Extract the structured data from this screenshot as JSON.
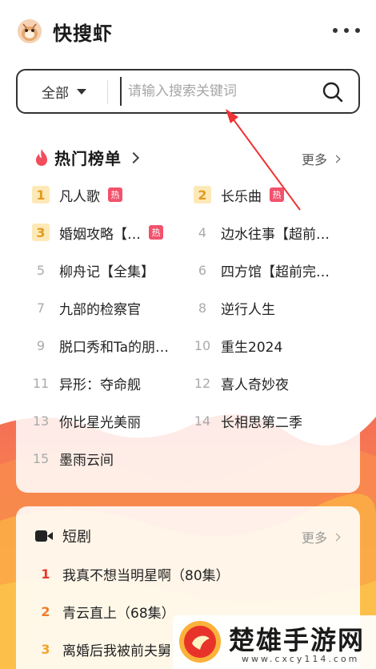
{
  "app": {
    "title": "快搜虾",
    "logo_icon": "shrimp-mascot-avatar"
  },
  "header": {
    "more_icon": "more-dots-icon"
  },
  "search": {
    "scope_label": "全部",
    "placeholder": "请输入搜索关键词",
    "value": ""
  },
  "hot_list": {
    "title": "热门榜单",
    "more_label": "更多",
    "hot_badge": "热",
    "items": [
      {
        "rank": "1",
        "name": "凡人歌",
        "hot": true
      },
      {
        "rank": "2",
        "name": "长乐曲",
        "hot": true
      },
      {
        "rank": "3",
        "name": "婚姻攻略【…",
        "hot": true
      },
      {
        "rank": "4",
        "name": "边水往事【超前…",
        "hot": false
      },
      {
        "rank": "5",
        "name": "柳舟记【全集】",
        "hot": false
      },
      {
        "rank": "6",
        "name": "四方馆【超前完…",
        "hot": false
      },
      {
        "rank": "7",
        "name": "九部的检察官",
        "hot": false
      },
      {
        "rank": "8",
        "name": "逆行人生",
        "hot": false
      },
      {
        "rank": "9",
        "name": "脱口秀和Ta的朋…",
        "hot": false
      },
      {
        "rank": "10",
        "name": "重生2024",
        "hot": false
      },
      {
        "rank": "11",
        "name": "异形：夺命舰",
        "hot": false
      },
      {
        "rank": "12",
        "name": "喜人奇妙夜",
        "hot": false
      },
      {
        "rank": "13",
        "name": "你比星光美丽",
        "hot": false
      },
      {
        "rank": "14",
        "name": "长相思第二季",
        "hot": false
      },
      {
        "rank": "15",
        "name": "墨雨云间",
        "hot": false
      }
    ]
  },
  "short_drama": {
    "title": "短剧",
    "more_label": "更多",
    "items": [
      {
        "rank": "1",
        "name": "我真不想当明星啊（80集）",
        "color": "#e5392f"
      },
      {
        "rank": "2",
        "name": "青云直上（68集）",
        "color": "#f07a2a"
      },
      {
        "rank": "3",
        "name": "离婚后我被前夫舅",
        "color": "#f0a42a"
      }
    ]
  },
  "watermark": {
    "name": "楚雄手游网",
    "url": "www.cxcy114.com"
  },
  "colors": {
    "accent_red": "#f2526c",
    "rank_top_bg": "#fde9b8",
    "rank_top_fg": "#e39b1f",
    "wave_orange": "#f7854a"
  }
}
